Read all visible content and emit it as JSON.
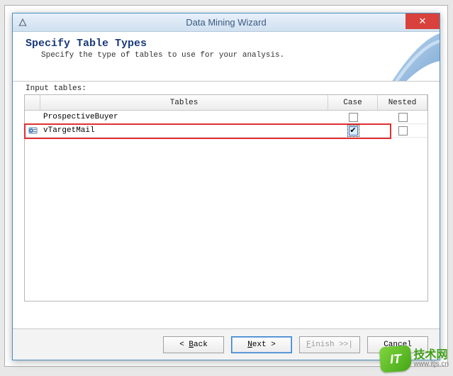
{
  "window": {
    "title": "Data Mining Wizard",
    "close_glyph": "✕"
  },
  "header": {
    "title": "Specify Table Types",
    "subtitle": "Specify the type of tables to use for your analysis."
  },
  "body": {
    "input_tables_label": "Input tables:"
  },
  "table": {
    "columns": {
      "tables": "Tables",
      "case": "Case",
      "nested": "Nested"
    },
    "rows": [
      {
        "name": "ProspectiveBuyer",
        "case": false,
        "nested": false,
        "has_icon": false
      },
      {
        "name": "vTargetMail",
        "case": true,
        "nested": false,
        "has_icon": true
      }
    ]
  },
  "footer": {
    "back": "< Back",
    "next": "Next >",
    "finish": "Finish >>|",
    "cancel": "Cancel"
  },
  "watermark": {
    "badge": "IT",
    "cn": "技术网",
    "url": "www.itjs.cn"
  }
}
